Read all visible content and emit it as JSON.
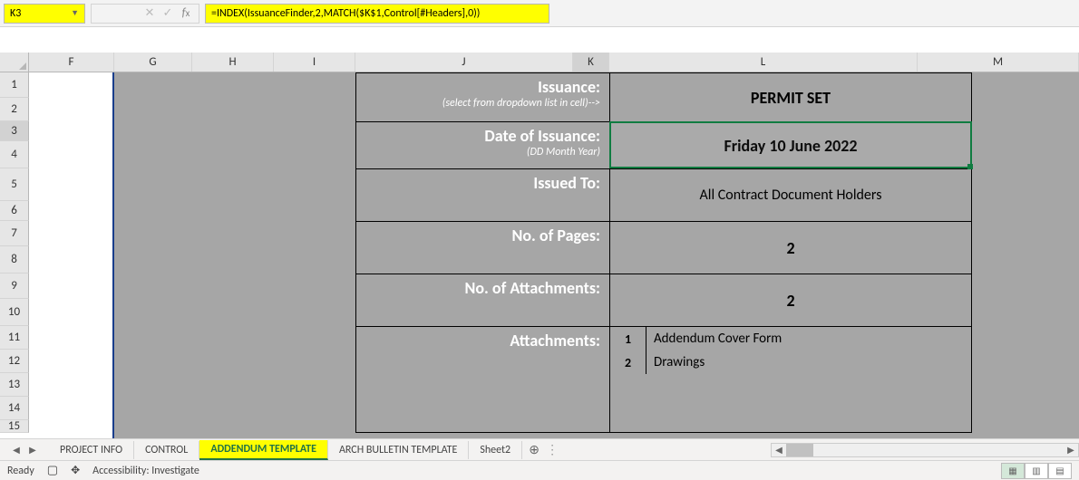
{
  "name_box": "K3",
  "formula": "=INDEX(IssuanceFinder,2,MATCH($K$1,Control[#Headers],0))",
  "columns": [
    "F",
    "G",
    "H",
    "I",
    "J",
    "K",
    "L",
    "M"
  ],
  "rows": [
    "1",
    "2",
    "3",
    "4",
    "5",
    "6",
    "7",
    "8",
    "9",
    "10",
    "11",
    "12",
    "13",
    "14",
    "15"
  ],
  "form": {
    "issuance_label": "Issuance:",
    "issuance_sub": "(select from dropdown list in cell)-->",
    "issuance_value": "PERMIT SET",
    "date_label": "Date of Issuance:",
    "date_sub": "(DD Month Year)",
    "date_value": "Friday 10 June 2022",
    "issued_to_label": "Issued To:",
    "issued_to_value": "All Contract Document Holders",
    "pages_label": "No. of Pages:",
    "pages_value": "2",
    "attach_count_label": "No. of Attachments:",
    "attach_count_value": "2",
    "attachments_label": "Attachments:",
    "attachments": [
      {
        "n": "1",
        "t": "Addendum Cover Form"
      },
      {
        "n": "2",
        "t": "Drawings"
      }
    ]
  },
  "tabs": {
    "items": [
      "PROJECT INFO",
      "CONTROL",
      "ADDENDUM TEMPLATE",
      "ARCH BULLETIN TEMPLATE",
      "Sheet2"
    ],
    "active_index": 2
  },
  "status": {
    "ready": "Ready",
    "accessibility": "Accessibility: Investigate"
  }
}
